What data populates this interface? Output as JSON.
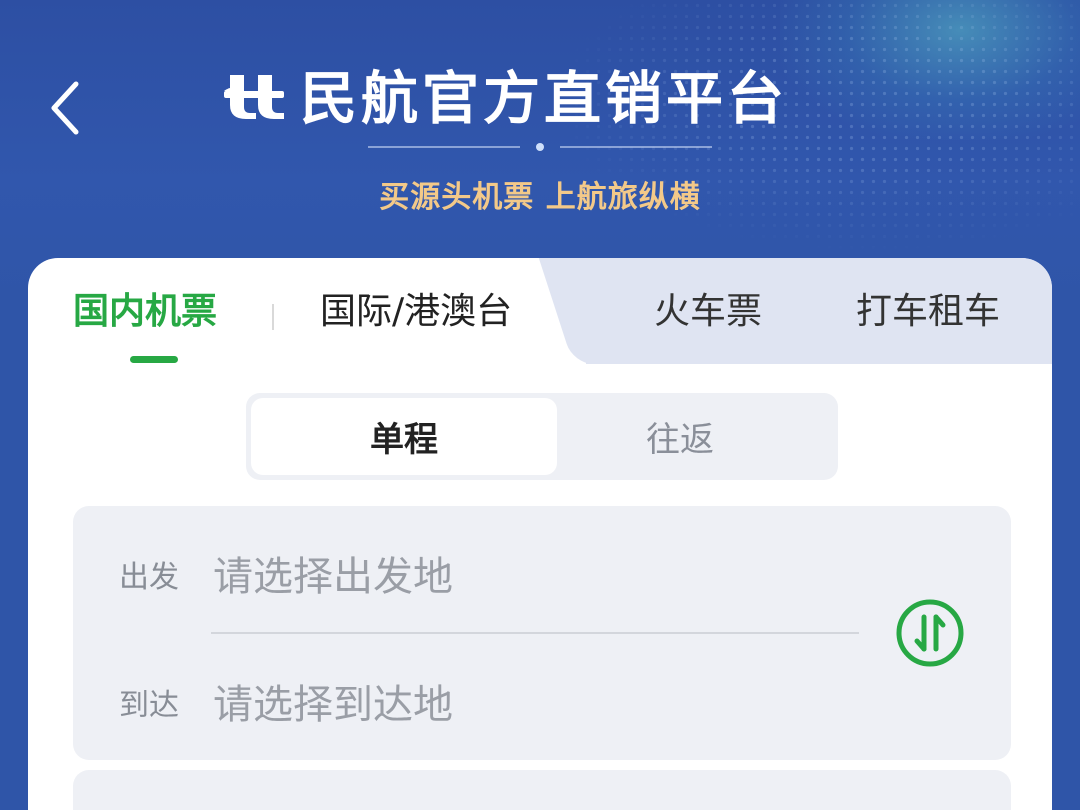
{
  "header": {
    "back_icon": "chevron-left-icon",
    "logo_icon": "airline-logo-icon",
    "title": "民航官方直销平台",
    "slogan": "买源头机票 上航旅纵横"
  },
  "tabs": [
    {
      "label": "国内机票",
      "active": true
    },
    {
      "label": "国际/港澳台",
      "active": false
    },
    {
      "label": "火车票",
      "active": false
    },
    {
      "label": "打车租车",
      "active": false
    }
  ],
  "trip_type": {
    "options": [
      "单程",
      "往返"
    ],
    "selected": "单程"
  },
  "route": {
    "departure_label": "出发",
    "departure_placeholder": "请选择出发地",
    "arrival_label": "到达",
    "arrival_placeholder": "请选择到达地",
    "swap_icon": "swap-icon"
  },
  "colors": {
    "brand_blue": "#2f55a8",
    "accent_green": "#27a844",
    "slogan_gold": "#f3c989"
  }
}
